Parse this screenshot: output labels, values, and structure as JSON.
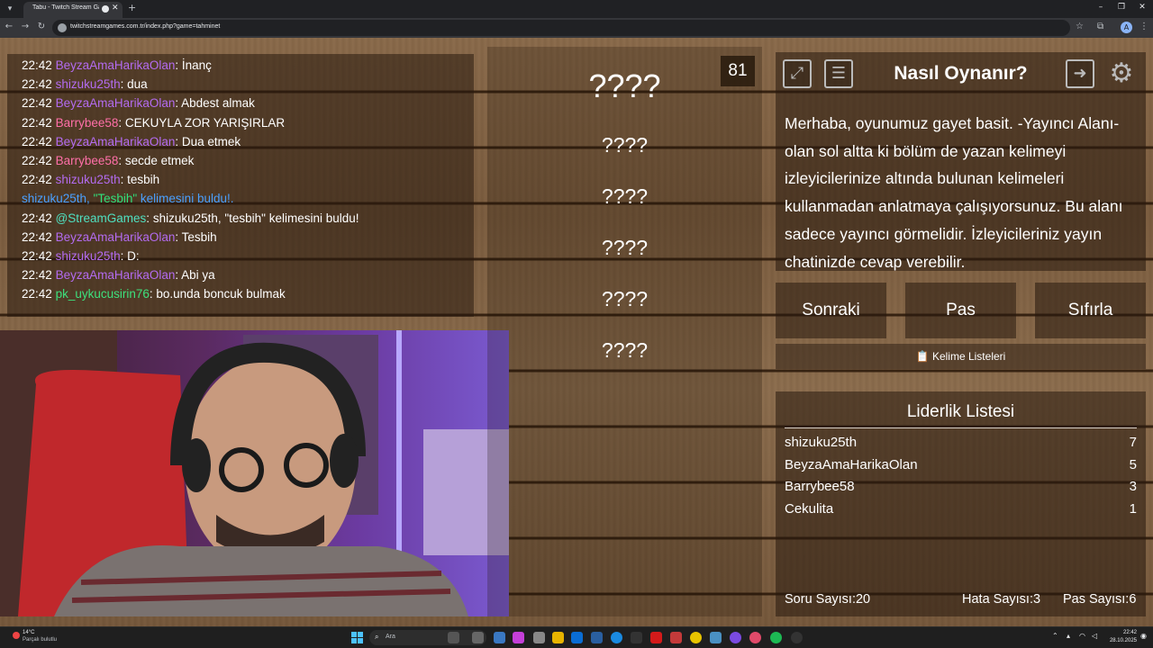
{
  "browser": {
    "tab_title": "Tabu - Twitch Stream Game",
    "url": "twitchstreamgames.com.tr/index.php?game=tahminet"
  },
  "chat": [
    {
      "time": "22:42",
      "user": "BeyzaAmaHarikaOlan",
      "color": "purple",
      "msg": "İnanç"
    },
    {
      "time": "22:42",
      "user": "shizuku25th",
      "color": "purple",
      "msg": "dua"
    },
    {
      "time": "22:42",
      "user": "BeyzaAmaHarikaOlan",
      "color": "purple",
      "msg": "Abdest almak"
    },
    {
      "time": "22:42",
      "user": "Barrybee58",
      "color": "pink",
      "msg": "CEKUYLA ZOR YARIŞIRLAR"
    },
    {
      "time": "22:42",
      "user": "BeyzaAmaHarikaOlan",
      "color": "purple",
      "msg": "Dua etmek"
    },
    {
      "time": "22:42",
      "user": "Barrybee58",
      "color": "pink",
      "msg": "secde etmek"
    },
    {
      "time": "22:42",
      "user": "shizuku25th",
      "color": "purple",
      "msg": "tesbih"
    }
  ],
  "system_notice": {
    "prefix": "shizuku25th, ",
    "word": "\"Tesbih\"",
    "suffix": " kelimesini buldu!."
  },
  "chat2": [
    {
      "time": "22:42",
      "user": "@StreamGames",
      "color": "teal",
      "msg": "shizuku25th, \"tesbih\" kelimesini buldu!"
    },
    {
      "time": "22:42",
      "user": "BeyzaAmaHarikaOlan",
      "color": "purple",
      "msg": "Tesbih"
    },
    {
      "time": "22:42",
      "user": "shizuku25th",
      "color": "purple",
      "msg": "D:"
    },
    {
      "time": "22:42",
      "user": "BeyzaAmaHarikaOlan",
      "color": "purple",
      "msg": "Abi ya"
    },
    {
      "time": "22:42",
      "user": "pk_uykucusirin76",
      "color": "green",
      "msg": "bo.unda boncuk bulmak"
    }
  ],
  "game": {
    "timer": "81",
    "main_word": "????",
    "taboo_words": [
      "????",
      "????",
      "????",
      "????",
      "????"
    ]
  },
  "howto": {
    "title": "Nasıl Oynanır?",
    "text": "Merhaba, oyunumuz gayet basit. -Yayıncı Alanı- olan sol altta ki bölüm de yazan kelimeyi izleyicilerinize altında bulunan kelimeleri kullanmadan anlatmaya çalışıyorsunuz. Bu alanı sadece yayıncı görmelidir. İzleyicileriniz yayın chatinizde cevap verebilir."
  },
  "buttons": {
    "next": "Sonraki",
    "pass": "Pas",
    "reset": "Sıfırla",
    "word_lists": "Kelime Listeleri"
  },
  "leaderboard": {
    "title": "Liderlik Listesi",
    "rows": [
      {
        "name": "shizuku25th",
        "score": "7"
      },
      {
        "name": "BeyzaAmaHarikaOlan",
        "score": "5"
      },
      {
        "name": "Barrybee58",
        "score": "3"
      },
      {
        "name": "Cekulita",
        "score": "1"
      }
    ],
    "stats": {
      "questions_label": "Soru Sayısı:",
      "questions": "20",
      "errors_label": "Hata Sayısı:",
      "errors": "3",
      "passes_label": "Pas Sayısı:",
      "passes": "6"
    }
  },
  "taskbar": {
    "weather_temp": "14°C",
    "weather_desc": "Parçalı bulutlu",
    "search_placeholder": "Ara",
    "time": "22:42",
    "date": "28.10.2025"
  }
}
